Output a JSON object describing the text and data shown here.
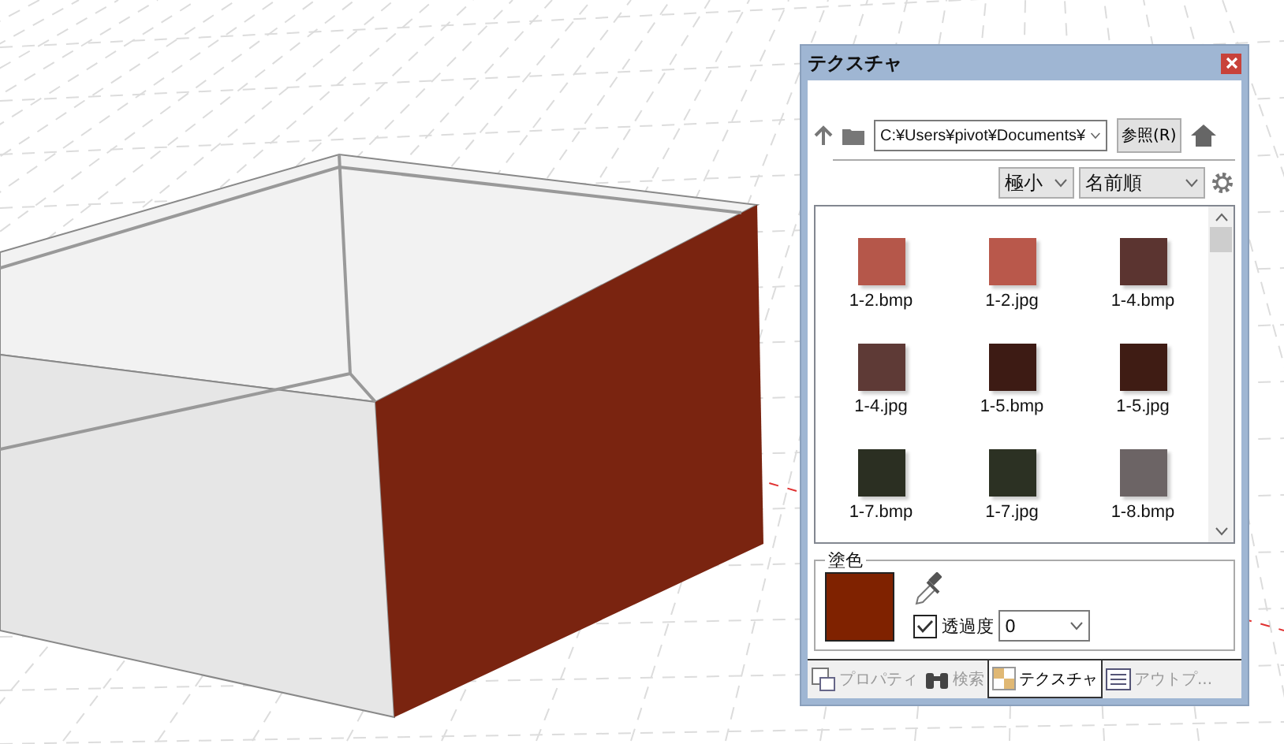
{
  "panel": {
    "title": "テクスチャ",
    "path": "C:¥Users¥pivot¥Documents¥",
    "browse_button": "参照(R)",
    "size_select": "極小",
    "sort_select": "名前順"
  },
  "textures": [
    {
      "name": "1-2.bmp",
      "color": "#b5574a"
    },
    {
      "name": "1-2.jpg",
      "color": "#b9584b"
    },
    {
      "name": "1-4.bmp",
      "color": "#5b3430"
    },
    {
      "name": "1-4.jpg",
      "color": "#5e3a36"
    },
    {
      "name": "1-5.bmp",
      "color": "#3d1b14"
    },
    {
      "name": "1-5.jpg",
      "color": "#3f1c14"
    },
    {
      "name": "1-7.bmp",
      "color": "#2b2f22"
    },
    {
      "name": "1-7.jpg",
      "color": "#2c3123"
    },
    {
      "name": "1-8.bmp",
      "color": "#6c6465"
    }
  ],
  "paint": {
    "label": "塗色",
    "color": "#7f2200",
    "transparency": {
      "label": "透過度",
      "checked": true,
      "value": "0"
    }
  },
  "tabs": [
    {
      "label": "プロパティ",
      "selected": false,
      "kind": "properties"
    },
    {
      "label": "検索",
      "selected": false,
      "kind": "search"
    },
    {
      "label": "テクスチャ",
      "selected": true,
      "kind": "texture"
    },
    {
      "label": "アウトプ...",
      "selected": false,
      "kind": "outline"
    }
  ]
}
